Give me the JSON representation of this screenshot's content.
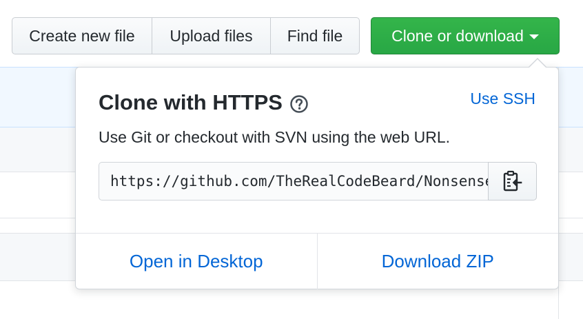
{
  "toolbar": {
    "create_new_file": "Create new file",
    "upload_files": "Upload files",
    "find_file": "Find file",
    "clone_or_download": "Clone or download"
  },
  "clone_popover": {
    "title": "Clone with HTTPS",
    "use_ssh": "Use SSH",
    "description": "Use Git or checkout with SVN using the web URL.",
    "url": "https://github.com/TheRealCodeBeard/Nonsense",
    "open_in_desktop": "Open in Desktop",
    "download_zip": "Download ZIP"
  },
  "icons": {
    "help": "question-circle-icon",
    "copy": "clipboard-icon",
    "dropdown": "caret-down-icon"
  },
  "colors": {
    "primary_green": "#28a745",
    "link_blue": "#0366d6",
    "text": "#24292e"
  }
}
